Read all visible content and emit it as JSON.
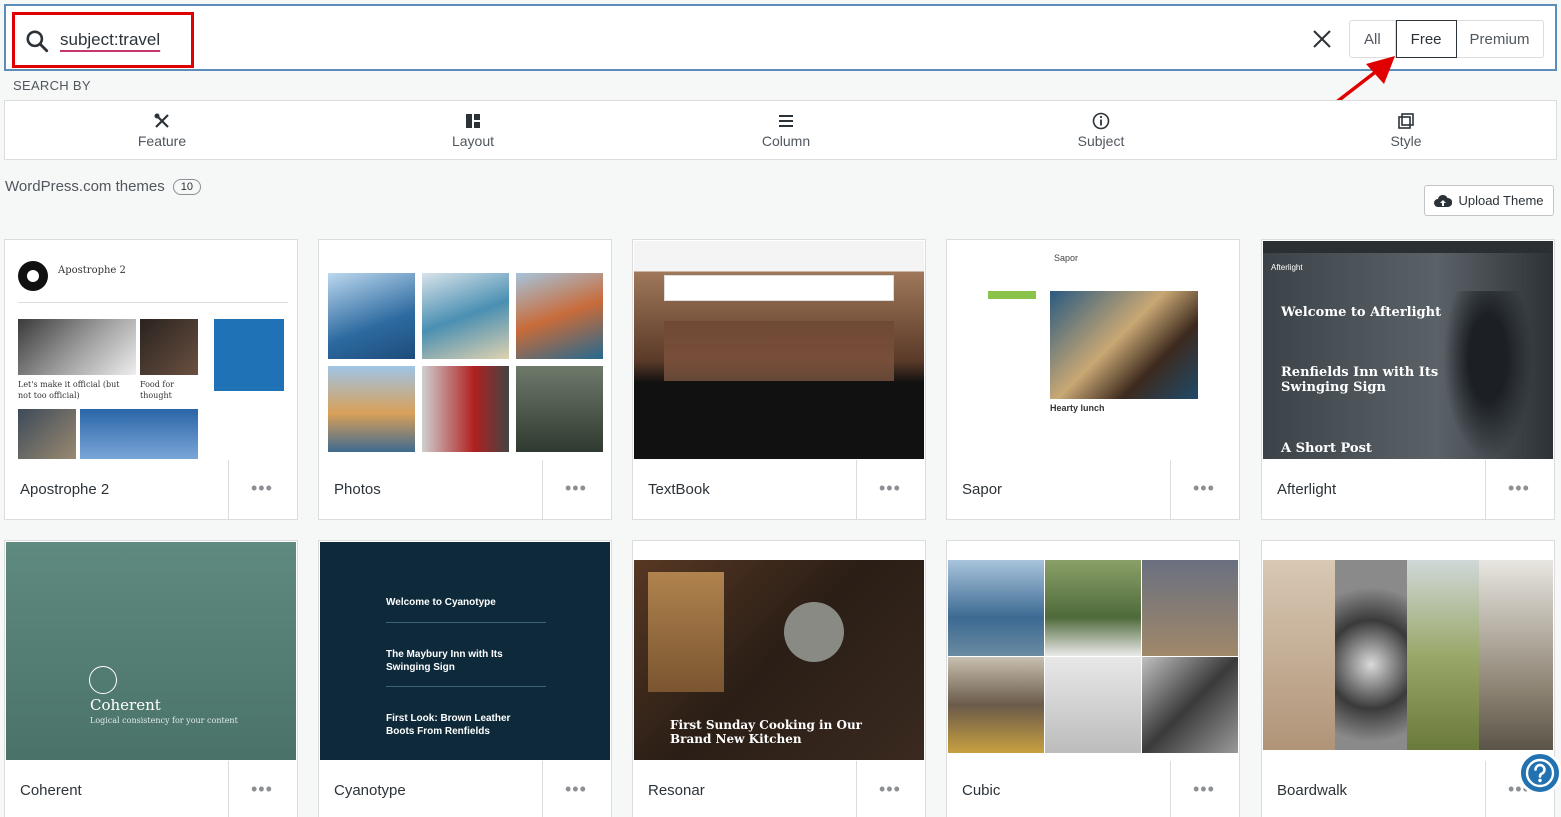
{
  "search": {
    "query": "subject:travel"
  },
  "filter_segments": {
    "all": "All",
    "free": "Free",
    "premium": "Premium",
    "active": "Free"
  },
  "search_by": {
    "label": "SEARCH BY",
    "items": [
      {
        "label": "Feature",
        "icon": "tools-icon"
      },
      {
        "label": "Layout",
        "icon": "layout-icon"
      },
      {
        "label": "Column",
        "icon": "column-icon"
      },
      {
        "label": "Subject",
        "icon": "info-icon"
      },
      {
        "label": "Style",
        "icon": "style-icon"
      }
    ]
  },
  "themes": {
    "heading": "WordPress.com themes",
    "count": "10",
    "upload_label": "Upload Theme",
    "items": [
      {
        "name": "Apostrophe 2"
      },
      {
        "name": "Photos"
      },
      {
        "name": "TextBook"
      },
      {
        "name": "Sapor"
      },
      {
        "name": "Afterlight"
      },
      {
        "name": "Coherent"
      },
      {
        "name": "Cyanotype"
      },
      {
        "name": "Resonar"
      },
      {
        "name": "Cubic"
      },
      {
        "name": "Boardwalk"
      }
    ]
  },
  "thumbnails": {
    "apostrophe": {
      "title": "Apostrophe 2",
      "post1": "Let's make it official (but not too official)",
      "post2": "Food for thought"
    },
    "afterlight": {
      "site": "Afterlight",
      "post1": "Welcome to Afterlight",
      "post2": "Renfields Inn with Its Swinging Sign",
      "post3": "A Short Post"
    },
    "sapor": {
      "site": "Sapor",
      "post": "Hearty lunch"
    },
    "coherent": {
      "title": "Coherent",
      "tagline": "Logical consistency for your content"
    },
    "cyanotype": {
      "post1": "Welcome to Cyanotype",
      "post2": "The Maybury Inn with Its Swinging Sign",
      "post3": "First Look: Brown Leather Boots From Renfields"
    },
    "resonar": {
      "post": "First Sunday Cooking in Our Brand New Kitchen"
    }
  },
  "colors": {
    "accent": "#2271b1",
    "highlight": "#e00000"
  }
}
